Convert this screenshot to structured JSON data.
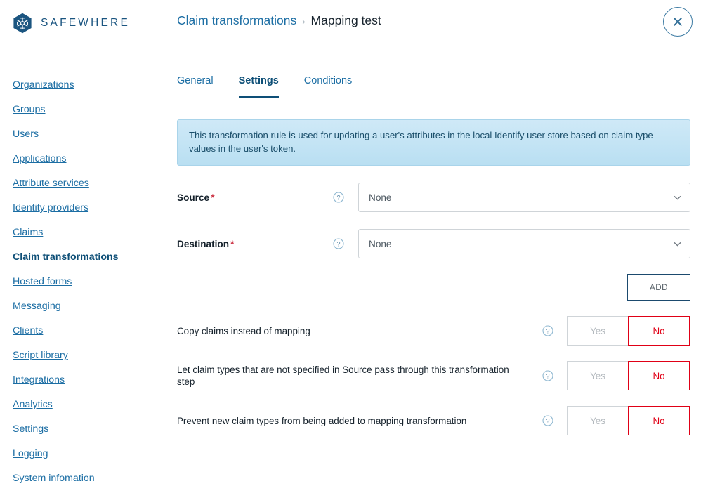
{
  "brand": {
    "name": "SAFEWHERE",
    "logo_icon": "safewhere-hexagon-snowflake-icon",
    "logo_color": "#1b5580"
  },
  "header": {
    "breadcrumb": {
      "parent": "Claim transformations",
      "separator": "›",
      "current": "Mapping test"
    },
    "close_icon": "close-x-circle-icon"
  },
  "sidebar": {
    "items": [
      {
        "label": "Organizations",
        "active": false
      },
      {
        "label": "Groups",
        "active": false
      },
      {
        "label": "Users",
        "active": false
      },
      {
        "label": "Applications",
        "active": false
      },
      {
        "label": "Attribute services",
        "active": false
      },
      {
        "label": "Identity providers",
        "active": false
      },
      {
        "label": "Claims",
        "active": false
      },
      {
        "label": "Claim transformations",
        "active": true
      },
      {
        "label": "Hosted forms",
        "active": false
      },
      {
        "label": "Messaging",
        "active": false
      },
      {
        "label": "Clients",
        "active": false
      },
      {
        "label": "Script library",
        "active": false
      },
      {
        "label": "Integrations",
        "active": false
      },
      {
        "label": "Analytics",
        "active": false
      },
      {
        "label": "Settings",
        "active": false
      },
      {
        "label": "Logging",
        "active": false
      },
      {
        "label": "System infomation",
        "active": false
      }
    ]
  },
  "main": {
    "tabs": [
      {
        "label": "General",
        "active": false
      },
      {
        "label": "Settings",
        "active": true
      },
      {
        "label": "Conditions",
        "active": false
      }
    ],
    "banner": {
      "text": "This transformation rule is used for updating a user's attributes in the local Identify user store based on claim type values in the user's token.",
      "background_top": "#cfe9f7",
      "background_bottom": "#b9dff2",
      "text_color": "#1b4f6b"
    },
    "fields": [
      {
        "label": "Source",
        "required": true,
        "required_marker": "*",
        "help_icon": "help-question-circle-icon",
        "value": "None",
        "chevron_icon": "chevron-down-icon"
      },
      {
        "label": "Destination",
        "required": true,
        "required_marker": "*",
        "help_icon": "help-question-circle-icon",
        "value": "None",
        "chevron_icon": "chevron-down-icon"
      }
    ],
    "add_button": {
      "label": "ADD",
      "border_color": "#1b4a6e"
    },
    "toggles": [
      {
        "label": "Copy claims instead of mapping",
        "help_icon": "help-question-circle-icon",
        "yes_label": "Yes",
        "no_label": "No",
        "selected": "No"
      },
      {
        "label": "Let claim types that are not specified in Source pass through this transformation step",
        "help_icon": "help-question-circle-icon",
        "yes_label": "Yes",
        "no_label": "No",
        "selected": "No"
      },
      {
        "label": "Prevent new claim types from being added to mapping transformation",
        "help_icon": "help-question-circle-icon",
        "yes_label": "Yes",
        "no_label": "No",
        "selected": "No"
      }
    ]
  },
  "colors": {
    "link_blue": "#1c6ea4",
    "active_blue": "#0e4f77",
    "required_red": "#cc3344",
    "selected_red": "#e00016",
    "muted_gray": "#b3b9be",
    "border_gray": "#cfd4d8"
  }
}
